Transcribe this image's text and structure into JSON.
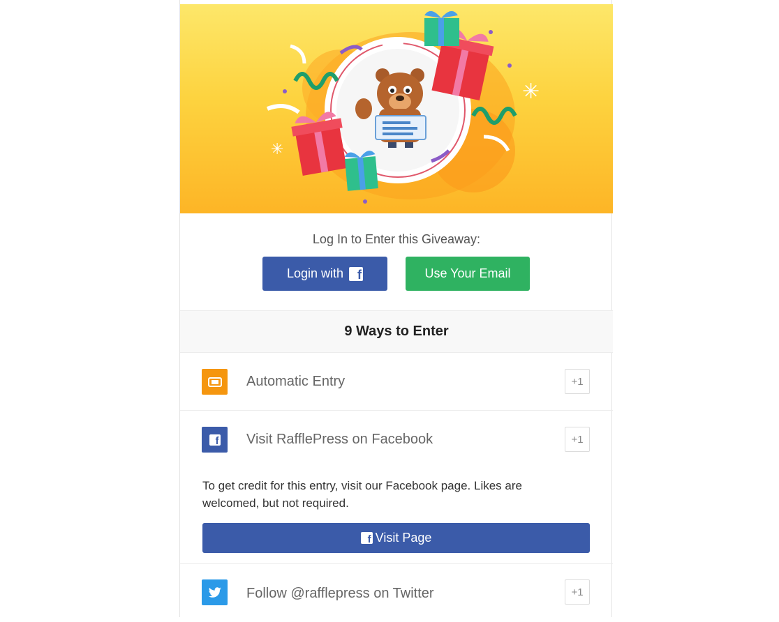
{
  "hero": {
    "image": "giveaway-bear-mascot-with-gifts"
  },
  "login": {
    "title": "Log In to Enter this Giveaway:",
    "facebook_button": "Login with",
    "email_button": "Use Your Email"
  },
  "ways": {
    "header": "9 Ways to Enter",
    "entries": [
      {
        "label": "Automatic Entry",
        "points": "+1",
        "icon": "ticket-icon",
        "color": "#f5960f"
      },
      {
        "label": "Visit RafflePress on Facebook",
        "points": "+1",
        "icon": "facebook-icon",
        "color": "#3b5ba9",
        "description": "To get credit for this entry, visit our Facebook page. Likes are welcomed, but not required.",
        "action": "Visit Page"
      },
      {
        "label": "Follow @rafflepress on Twitter",
        "points": "+1",
        "icon": "twitter-icon",
        "color": "#2b9ae8"
      }
    ]
  },
  "colors": {
    "facebook": "#3b5ba9",
    "email": "#2fb261",
    "accent": "#f5960f",
    "twitter": "#2b9ae8"
  }
}
